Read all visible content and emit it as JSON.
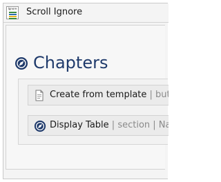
{
  "window": {
    "title": "Scroll Ignore",
    "icon_label": "Ignore",
    "icon": "scroll-ignore-app-icon"
  },
  "main": {
    "heading": "Chapters",
    "heading_icon": "compass-icon",
    "rows": [
      {
        "name": "Create from template",
        "meta": " | butt",
        "icon": "template-doc-icon"
      },
      {
        "name": "Display Table",
        "meta": " | section | Nar",
        "icon": "compass-icon"
      }
    ]
  },
  "colors": {
    "heading": "#1f3a6b",
    "icon_fill": "#1f3a6b",
    "meta_text": "#8a8a8a"
  }
}
